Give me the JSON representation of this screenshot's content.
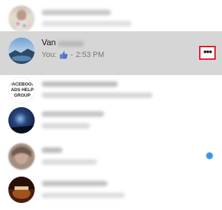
{
  "conversations": [
    {
      "name": "",
      "preview": "",
      "time": ""
    },
    {
      "name": "Van",
      "you_prefix": "You:",
      "time": "2:53 PM",
      "preview_icon": "thumbs-up-icon",
      "selected": true
    },
    {
      "name": "",
      "preview": "",
      "avatar_text": "FACEBOOK ADS HELP GROUP"
    },
    {
      "name": "",
      "preview": ""
    },
    {
      "name": "",
      "preview": "",
      "unread": true
    },
    {
      "name": "",
      "preview": ""
    }
  ],
  "more_button": {
    "label": "•••",
    "icon": "more-options-icon"
  },
  "colors": {
    "selected_row": "#d6d6d6",
    "highlight_border": "#e0162b",
    "unread_dot": "#3b95e6",
    "like_icon": "#4a73c8"
  }
}
